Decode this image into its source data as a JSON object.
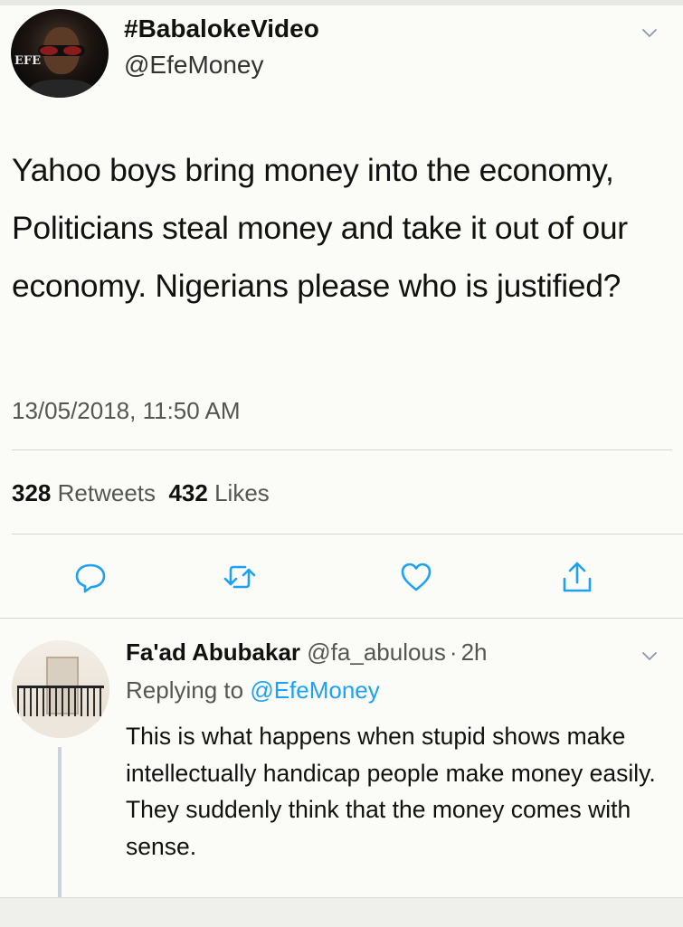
{
  "tweet": {
    "display_name": "#BabalokeVideo",
    "handle": "@EfeMoney",
    "avatar_logo": "EFE",
    "text": "Yahoo boys bring money into the economy, Politicians steal money and take it out of our economy. Nigerians please who is justified?",
    "timestamp": "13/05/2018, 11:50 AM",
    "retweets_count": "328",
    "retweets_label": "Retweets",
    "likes_count": "432",
    "likes_label": "Likes"
  },
  "actions": [
    {
      "icon": "reply-icon"
    },
    {
      "icon": "retweet-icon"
    },
    {
      "icon": "like-icon"
    },
    {
      "icon": "share-icon"
    }
  ],
  "reply": {
    "display_name": "Fa'ad Abubakar",
    "handle": "@fa_abulous",
    "separator": "·",
    "time": "2h",
    "replying_to_label": "Replying to",
    "replying_to_handle": "@EfeMoney",
    "text": "This is what happens when stupid shows make intellectually handicap people make money easily. They suddenly think that the money comes with sense."
  },
  "colors": {
    "link": "#1da1f2",
    "secondary_text": "#555555",
    "icon": "#1da1f2"
  }
}
